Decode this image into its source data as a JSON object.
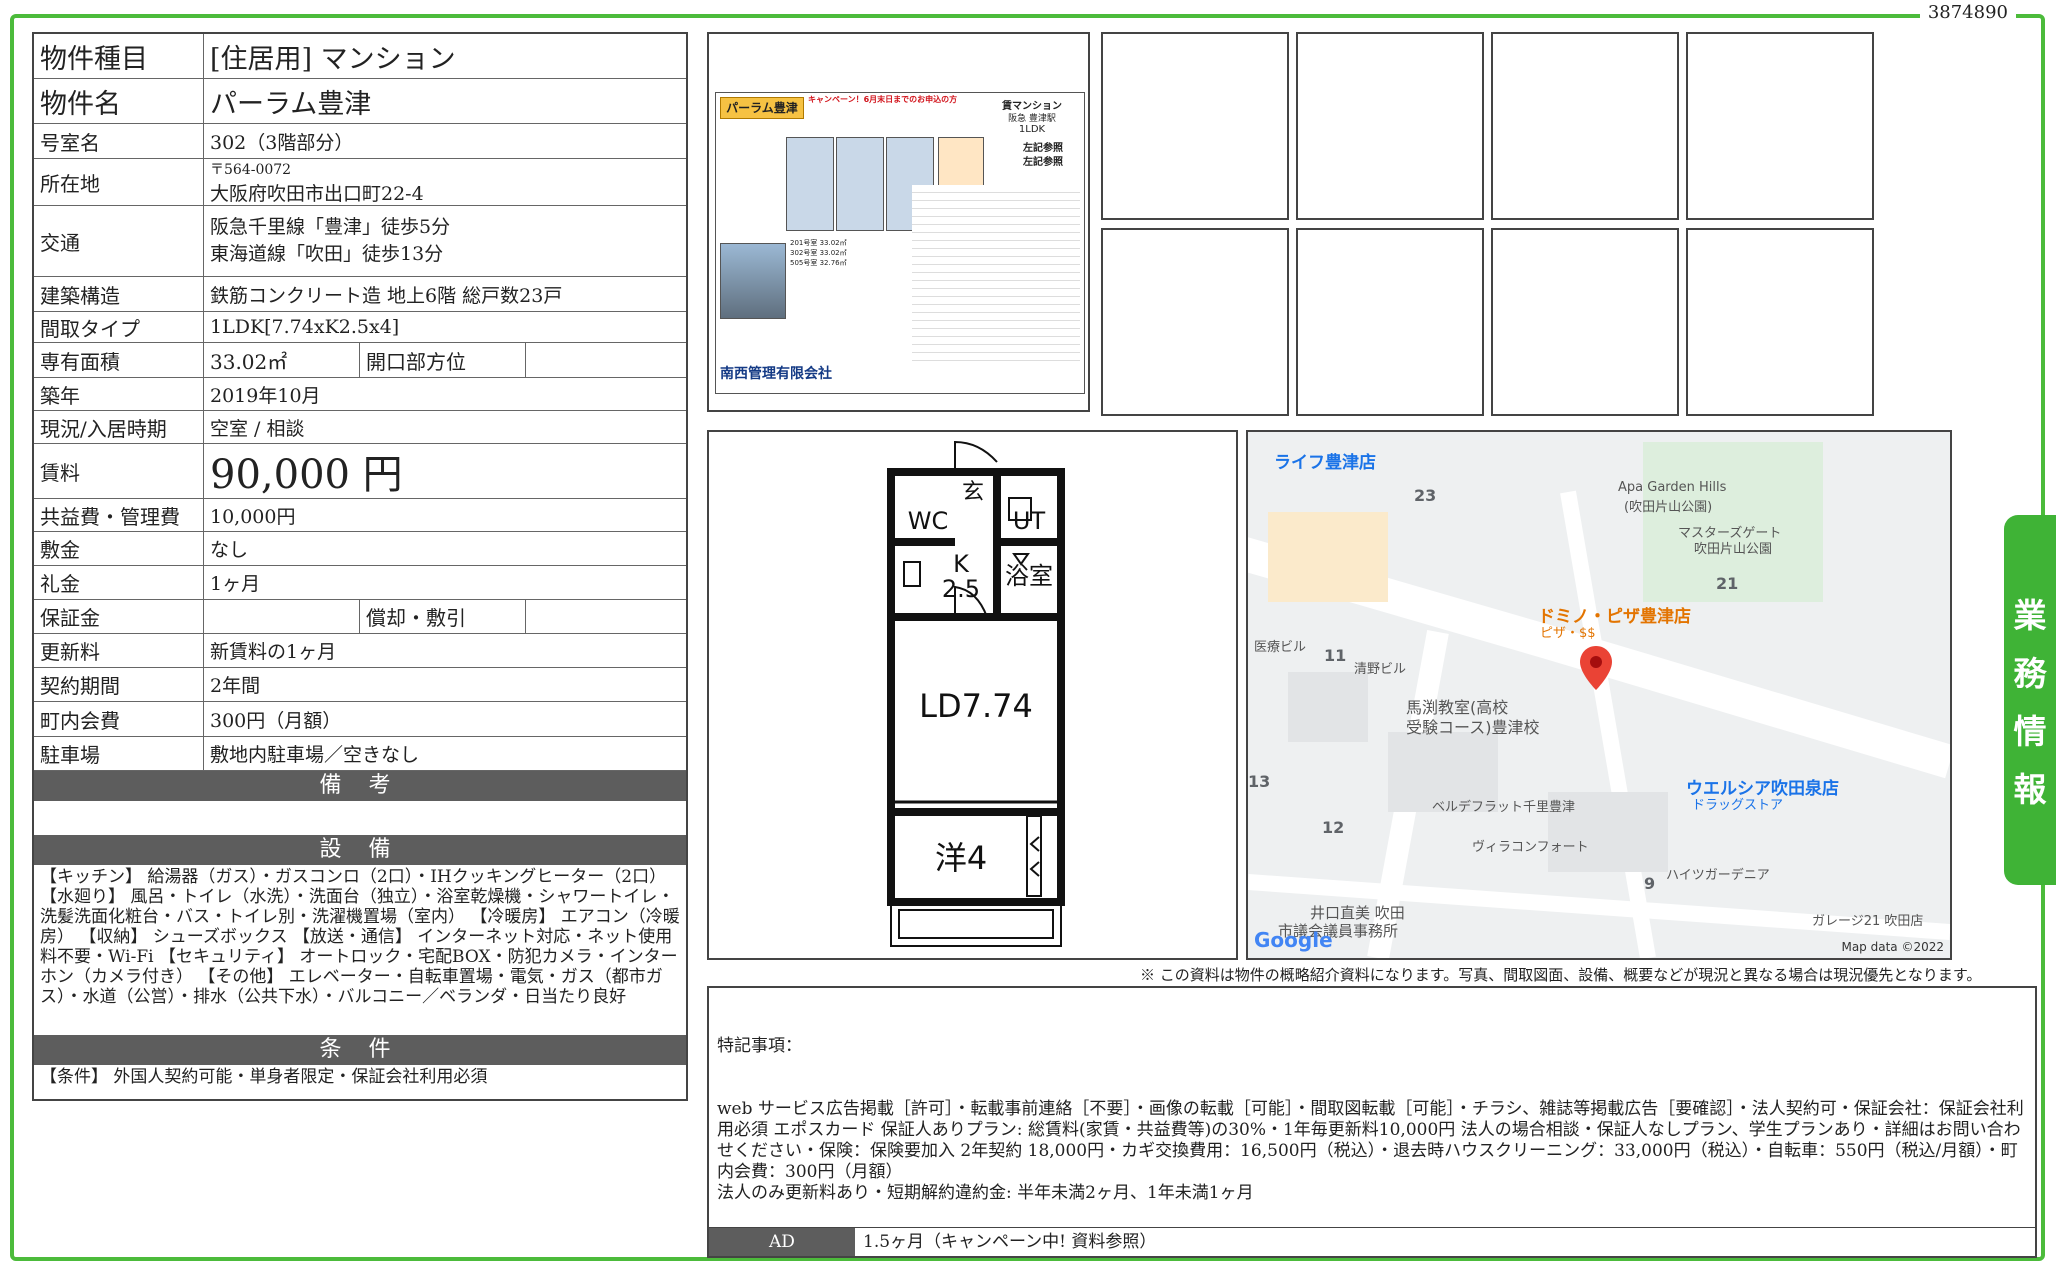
{
  "property_id": "3874890",
  "side_tab": [
    "業",
    "務",
    "情",
    "報"
  ],
  "rows": {
    "type": {
      "label": "物件種目",
      "value": "[住居用] マンション"
    },
    "name": {
      "label": "物件名",
      "value": "パーラム豊津"
    },
    "room": {
      "label": "号室名",
      "value": "302（3階部分）"
    },
    "address": {
      "label": "所在地",
      "zip": "〒564-0072",
      "value": "大阪府吹田市出口町22-4"
    },
    "access": {
      "label": "交通",
      "line1": "阪急千里線「豊津」徒歩5分",
      "line2": "東海道線「吹田」徒歩13分"
    },
    "structure": {
      "label": "建築構造",
      "value": "鉄筋コンクリート造 地上6階 総戸数23戸"
    },
    "layout": {
      "label": "間取タイプ",
      "value": "1LDK[7.74xK2.5x4]"
    },
    "area": {
      "label": "専有面積",
      "value": "33.02㎡",
      "sub_label": "開口部方位",
      "sub_value": ""
    },
    "built": {
      "label": "築年",
      "value": "2019年10月"
    },
    "status": {
      "label": "現況/入居時期",
      "value": "空室 / 相談"
    },
    "rent": {
      "label": "賃料",
      "value": "90,000 円"
    },
    "fee": {
      "label": "共益費・管理費",
      "value": "10,000円"
    },
    "deposit": {
      "label": "敷金",
      "value": "なし"
    },
    "key_money": {
      "label": "礼金",
      "value": "1ヶ月"
    },
    "guarantee": {
      "label": "保証金",
      "value": "",
      "sub_label": "償却・敷引",
      "sub_value": ""
    },
    "renewal": {
      "label": "更新料",
      "value": "新賃料の1ヶ月"
    },
    "contract": {
      "label": "契約期間",
      "value": "2年間"
    },
    "town_fee": {
      "label": "町内会費",
      "value": "300円（月額）"
    },
    "parking": {
      "label": "駐車場",
      "value": "敷地内駐車場／空きなし"
    }
  },
  "sections": {
    "remarks": {
      "title": "備 考",
      "body": ""
    },
    "equipment": {
      "title": "設 備",
      "body": "【キッチン】 給湯器（ガス）・ガスコンロ（2口）・IHクッキングヒーター（2口） 【水廻り】 風呂・トイレ（水洗）・洗面台（独立）・浴室乾燥機・シャワートイレ・洗髪洗面化粧台・バス・トイレ別・洗濯機置場（室内） 【冷暖房】 エアコン（冷暖房） 【収納】 シューズボックス 【放送・通信】 インターネット対応・ネット使用料不要・Wi-Fi 【セキュリティ】 オートロック・宅配BOX・防犯カメラ・インターホン（カメラ付き） 【その他】 エレベーター・自転車置場・電気・ガス（都市ガス）・水道（公営）・排水（公共下水）・バルコニー／ベランダ・日当たり良好"
    },
    "conditions": {
      "title": "条 件",
      "body": "【条件】 外国人契約可能・単身者限定・保証会社利用必須"
    }
  },
  "flyer": {
    "title": "パーラム豊津",
    "campaign": "キャンペーン！6月末日までのお申込の方",
    "type_label": "賃マンション",
    "station": "阪急 豊津駅",
    "layout": "1LDK",
    "ref1": "左記参照",
    "ref2": "左記参照",
    "company": "南西管理有限会社",
    "rooms": [
      "201号室 33.02㎡",
      "302号室 33.02㎡",
      "505号室 32.76㎡"
    ]
  },
  "floorplan": {
    "labels": {
      "entry": "玄",
      "wc": "WC",
      "ut": "UT",
      "k": "K",
      "k_size": "2.5",
      "bath": "浴室",
      "ld": "LD7.74",
      "western": "洋4"
    }
  },
  "map": {
    "places": [
      "ライフ豊津店",
      "Apa Garden Hills",
      "(吹田片山公園)",
      "マスターズゲート",
      "吹田片山公園",
      "ドミノ・ピザ豊津店",
      "ピザ・$$",
      "医療ビル",
      "清野ビル",
      "馬渕教室(高校",
      "受験コース)豊津校",
      "ウエルシア吹田泉店",
      "ドラッグストア",
      "ベルデフラット千里豊津",
      "ヴィラコンフォート",
      "ハイツガーデニア",
      "ガレージ21 吹田店",
      "井口直美 吹田",
      "市議会議員事務所"
    ],
    "numbers": [
      "23",
      "21",
      "11",
      "13",
      "12",
      "9"
    ],
    "attribution": "Map data ©2022",
    "logo": "Google"
  },
  "notice": "※ この資料は物件の概略紹介資料になります。写真、間取図面、設備、概要などが現況と異なる場合は現況優先となります。",
  "special_notes": {
    "title": "特記事項：",
    "body": "web サービス広告掲載［許可］・転載事前連絡［不要］・画像の転載［可能］・間取図転載［可能］・チラシ、雑誌等掲載広告［要確認］・法人契約可・保証会社：保証会社利用必須 エポスカード 保証人ありプラン: 総賃料(家賃・共益費等)の30%・1年毎更新料10,000円 法人の場合相談・保証人なしプラン、学生プランあり・詳細はお問い合わせください・保険：保険要加入 2年契約 18,000円・カギ交換費用：16,500円（税込）・退去時ハウスクリーニング：33,000円（税込）・自転車：550円（税込/月額）・町内会費：300円（月額）\n法人のみ更新料あり・短期解約違約金: 半年未満2ヶ月、1年未満1ヶ月"
  },
  "ad": {
    "label": "AD",
    "value": "1.5ヶ月（キャンペーン中! 資料参照）"
  }
}
